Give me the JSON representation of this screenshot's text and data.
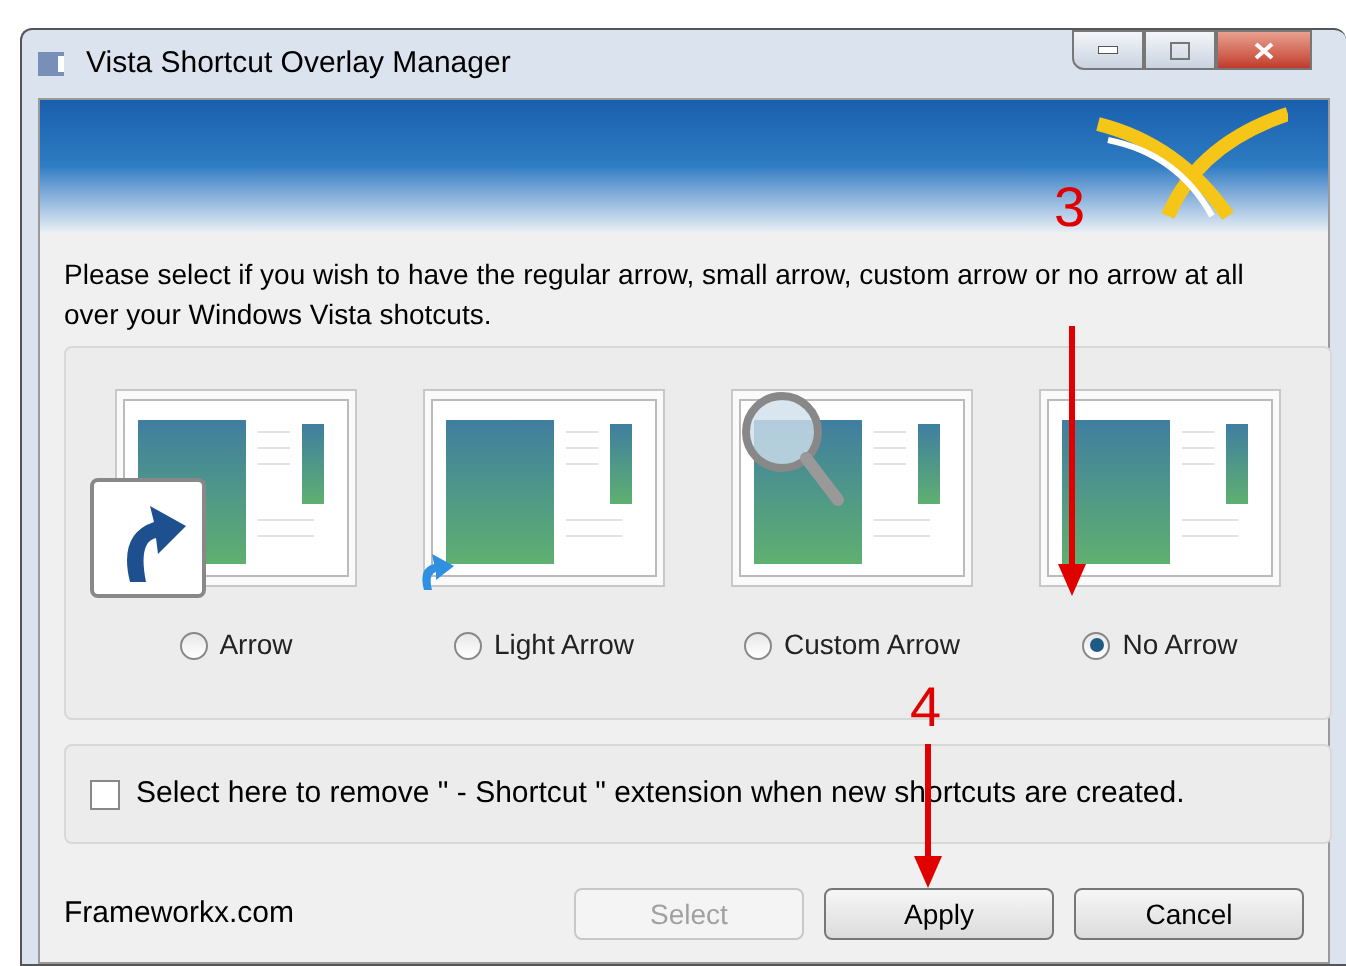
{
  "window": {
    "title": "Vista Shortcut Overlay Manager"
  },
  "instructions": "Please select if you wish to have the regular arrow, small arrow, custom arrow or no arrow at all over your Windows Vista shotcuts.",
  "options": [
    {
      "label": "Arrow",
      "kind": "large-arrow",
      "selected": false
    },
    {
      "label": "Light Arrow",
      "kind": "small-arrow",
      "selected": false
    },
    {
      "label": "Custom Arrow",
      "kind": "magnifier",
      "selected": false
    },
    {
      "label": "No Arrow",
      "kind": "none",
      "selected": true
    }
  ],
  "extension_checkbox": {
    "label": "Select here to remove \" - Shortcut \" extension when new shortcuts are created.",
    "checked": false
  },
  "footer": {
    "site": "Frameworkx.com"
  },
  "buttons": [
    {
      "label": "Select",
      "disabled": true
    },
    {
      "label": "Apply",
      "disabled": false
    },
    {
      "label": "Cancel",
      "disabled": false
    }
  ],
  "annotations": [
    {
      "label": "3"
    },
    {
      "label": "4"
    }
  ]
}
